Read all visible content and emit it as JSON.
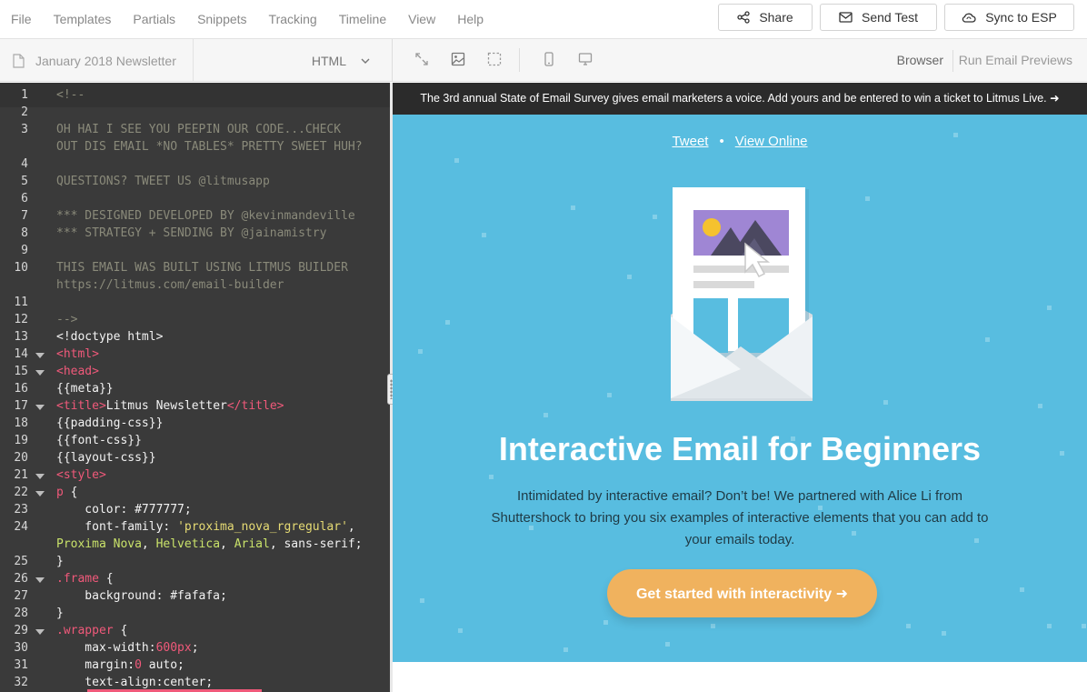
{
  "menu": {
    "items": [
      "File",
      "Templates",
      "Partials",
      "Snippets",
      "Tracking",
      "Timeline",
      "View",
      "Help"
    ]
  },
  "actions": {
    "share": "Share",
    "send_test": "Send Test",
    "sync": "Sync to ESP"
  },
  "file": {
    "name": "January 2018 Newsletter",
    "language": "HTML"
  },
  "preview_toolbar": {
    "browser": "Browser",
    "run_previews": "Run Email Previews",
    "icons": [
      "expand-icon",
      "image-icon",
      "selection-icon",
      "mobile-icon",
      "desktop-icon"
    ]
  },
  "editor": {
    "lines": [
      {
        "n": "1",
        "text": "<!--",
        "cls": "comment",
        "fold": false
      },
      {
        "n": "2",
        "text": "",
        "cls": "comment",
        "fold": false
      },
      {
        "n": "3",
        "text": "OH HAI I SEE YOU PEEPIN OUR CODE...CHECK",
        "cls": "comment",
        "fold": false
      },
      {
        "n": "",
        "text": "OUT DIS EMAIL *NO TABLES* PRETTY SWEET HUH?",
        "cls": "comment",
        "fold": false
      },
      {
        "n": "4",
        "text": "",
        "cls": "comment",
        "fold": false
      },
      {
        "n": "5",
        "text": "QUESTIONS? TWEET US @litmusapp",
        "cls": "comment",
        "fold": false
      },
      {
        "n": "6",
        "text": "",
        "cls": "comment",
        "fold": false
      },
      {
        "n": "7",
        "text": "*** DESIGNED DEVELOPED BY @kevinmandeville",
        "cls": "comment",
        "fold": false
      },
      {
        "n": "8",
        "text": "*** STRATEGY + SENDING BY @jainamistry",
        "cls": "comment",
        "fold": false
      },
      {
        "n": "9",
        "text": "",
        "cls": "comment",
        "fold": false
      },
      {
        "n": "10",
        "text": "THIS EMAIL WAS BUILT USING LITMUS BUILDER",
        "cls": "comment",
        "fold": false
      },
      {
        "n": "",
        "text": "https://litmus.com/email-builder",
        "cls": "comment",
        "fold": false
      },
      {
        "n": "11",
        "text": "",
        "cls": "comment",
        "fold": false
      },
      {
        "n": "12",
        "text": "-->",
        "cls": "comment",
        "fold": false
      },
      {
        "n": "13",
        "text": "<!doctype html>",
        "cls": "plain",
        "fold": false
      },
      {
        "n": "14",
        "text": "<html>",
        "cls": "tag",
        "fold": true
      },
      {
        "n": "15",
        "text": "<head>",
        "cls": "tag",
        "fold": true
      },
      {
        "n": "16",
        "text": "{{meta}}",
        "cls": "plain",
        "fold": false
      },
      {
        "n": "17",
        "text": "",
        "cls": "title",
        "fold": true
      },
      {
        "n": "18",
        "text": "{{padding-css}}",
        "cls": "plain",
        "fold": false
      },
      {
        "n": "19",
        "text": "{{font-css}}",
        "cls": "plain",
        "fold": false
      },
      {
        "n": "20",
        "text": "{{layout-css}}",
        "cls": "plain",
        "fold": false
      },
      {
        "n": "21",
        "text": "<style>",
        "cls": "tag",
        "fold": true
      },
      {
        "n": "22",
        "text": "",
        "cls": "ptag",
        "fold": true
      },
      {
        "n": "23",
        "text": "",
        "cls": "color",
        "fold": false
      },
      {
        "n": "24",
        "text": "",
        "cls": "font1",
        "fold": false
      },
      {
        "n": "",
        "text": "",
        "cls": "font2",
        "fold": false
      },
      {
        "n": "25",
        "text": "}",
        "cls": "plain",
        "fold": false
      },
      {
        "n": "26",
        "text": "",
        "cls": "frame",
        "fold": true
      },
      {
        "n": "27",
        "text": "    background: #fafafa;",
        "cls": "plain",
        "fold": false
      },
      {
        "n": "28",
        "text": "}",
        "cls": "plain",
        "fold": false
      },
      {
        "n": "29",
        "text": "",
        "cls": "wrapper",
        "fold": true
      },
      {
        "n": "30",
        "text": "",
        "cls": "maxw",
        "fold": false
      },
      {
        "n": "31",
        "text": "",
        "cls": "margin",
        "fold": false
      },
      {
        "n": "32",
        "text": "    text-align:center;",
        "cls": "plain",
        "fold": false
      }
    ],
    "tokens": {
      "title_open": "<title>",
      "title_text": "Litmus Newsletter",
      "title_close": "</title>",
      "p_sel": "p",
      "brace": " {",
      "color_prop": "    color: ",
      "color_val": "#777777;",
      "ff_prop": "    font-family: ",
      "ff_str": "'proxima_nova_rgregular'",
      "ff_comma": ",",
      "ff_l2_a": "Proxima Nova",
      "ff_l2_b": ", ",
      "ff_l2_c": "Helvetica",
      "ff_l2_d": ", ",
      "ff_l2_e": "Arial",
      "ff_l2_f": ", sans-serif;",
      "frame_sel": ".frame",
      "wrapper_sel": ".wrapper",
      "maxw_prop": "    max-width:",
      "maxw_val": "600px",
      "maxw_end": ";",
      "margin_prop": "    margin:",
      "margin_val": "0",
      "margin_end": " auto;"
    }
  },
  "preview": {
    "banner": "The 3rd annual State of Email Survey gives email marketers a voice. Add yours and be entered to win a ticket to Litmus Live. ➜",
    "tweet": "Tweet",
    "dot": "•",
    "view_online": "View Online",
    "title": "Interactive Email for Beginners",
    "body": "Intimidated by interactive email? Don’t be! We partnered with Alice Li from Shuttershock to bring you six examples of interactive elements that you can add to your emails today.",
    "cta": "Get started with interactivity ➜"
  },
  "colors": {
    "hero_bg": "#58bde0",
    "cta_bg": "#f0b25e",
    "editor_bg": "#3a3a3a",
    "banner_bg": "#2b2b2b"
  }
}
